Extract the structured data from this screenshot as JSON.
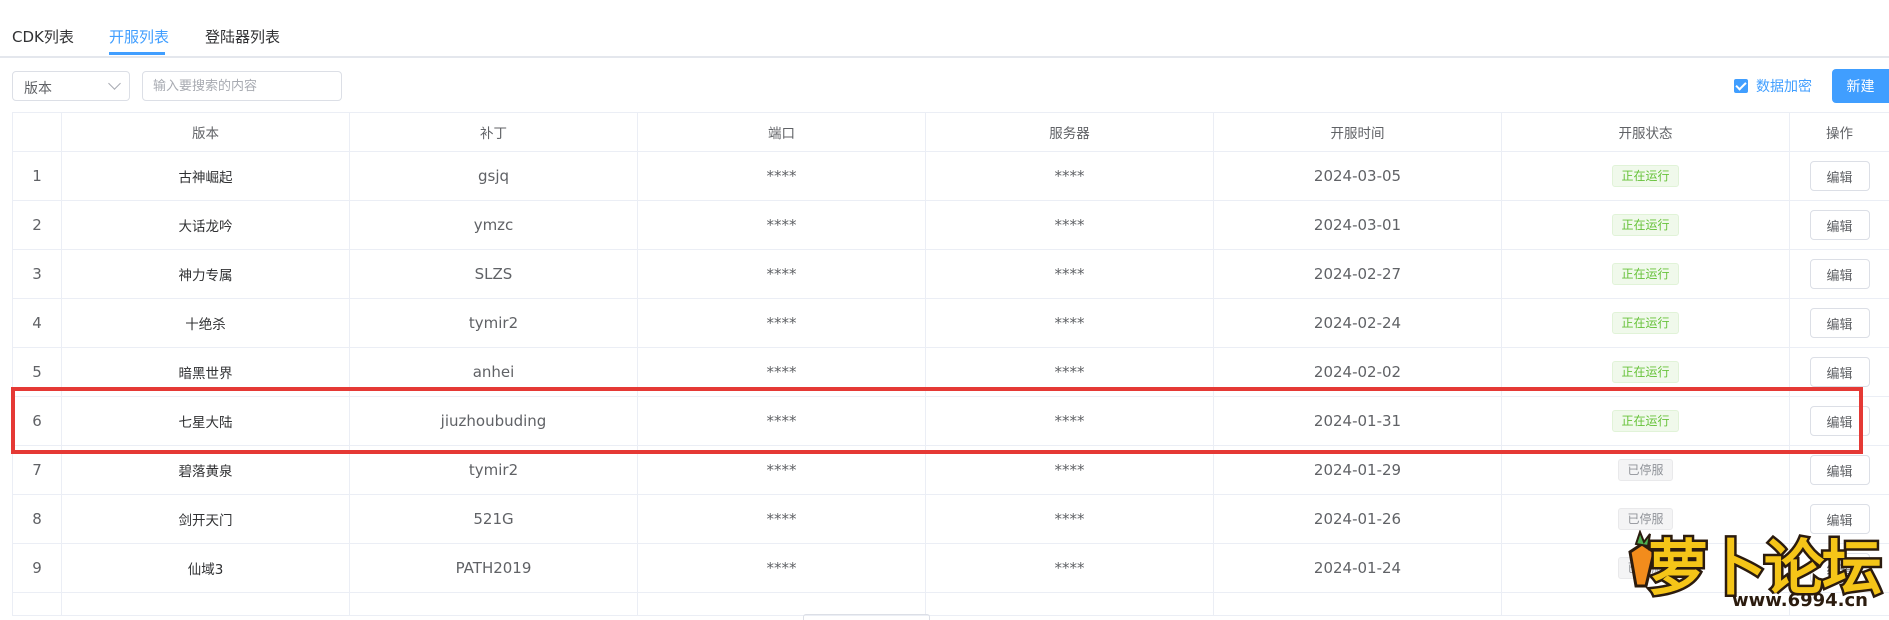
{
  "tabs": [
    {
      "label": "CDK列表"
    },
    {
      "label": "开服列表"
    },
    {
      "label": "登陆器列表"
    }
  ],
  "filter": {
    "select_value": "版本",
    "search_placeholder": "输入要搜索的内容"
  },
  "encrypt": {
    "label": "数据加密",
    "checked": true
  },
  "new_button": "新建",
  "columns": [
    "",
    "版本",
    "补丁",
    "端口",
    "服务器",
    "开服时间",
    "开服状态",
    "操作"
  ],
  "rows": [
    {
      "idx": "1",
      "version": "古神崛起",
      "patch": "gsjq",
      "port": "****",
      "server": "****",
      "date": "2024-03-05",
      "status": "正在运行",
      "action": "编辑"
    },
    {
      "idx": "2",
      "version": "大话龙吟",
      "patch": "ymzc",
      "port": "****",
      "server": "****",
      "date": "2024-03-01",
      "status": "正在运行",
      "action": "编辑"
    },
    {
      "idx": "3",
      "version": "神力专属",
      "patch": "SLZS",
      "port": "****",
      "server": "****",
      "date": "2024-02-27",
      "status": "正在运行",
      "action": "编辑"
    },
    {
      "idx": "4",
      "version": "十绝杀",
      "patch": "tymir2",
      "port": "****",
      "server": "****",
      "date": "2024-02-24",
      "status": "正在运行",
      "action": "编辑"
    },
    {
      "idx": "5",
      "version": "暗黑世界",
      "patch": "anhei",
      "port": "****",
      "server": "****",
      "date": "2024-02-02",
      "status": "正在运行",
      "action": "编辑"
    },
    {
      "idx": "6",
      "version": "七星大陆",
      "patch": "jiuzhoubuding",
      "port": "****",
      "server": "****",
      "date": "2024-01-31",
      "status": "正在运行",
      "action": "编辑"
    },
    {
      "idx": "7",
      "version": "碧落黄泉",
      "patch": "tymir2",
      "port": "****",
      "server": "****",
      "date": "2024-01-29",
      "status": "已停服",
      "action": "编辑"
    },
    {
      "idx": "8",
      "version": "剑开天门",
      "patch": "521G",
      "port": "****",
      "server": "****",
      "date": "2024-01-26",
      "status": "已停服",
      "action": "编辑"
    },
    {
      "idx": "9",
      "version": "仙域3",
      "patch": "PATH2019",
      "port": "****",
      "server": "****",
      "date": "2024-01-24",
      "status": "已停服",
      "action": "编辑"
    }
  ],
  "watermark": {
    "text": "萝卜论坛",
    "url": "www.6994.cn"
  },
  "colors": {
    "accent": "#409eff",
    "running": "#67c23a",
    "stopped": "#909399",
    "highlight": "#e53935"
  }
}
